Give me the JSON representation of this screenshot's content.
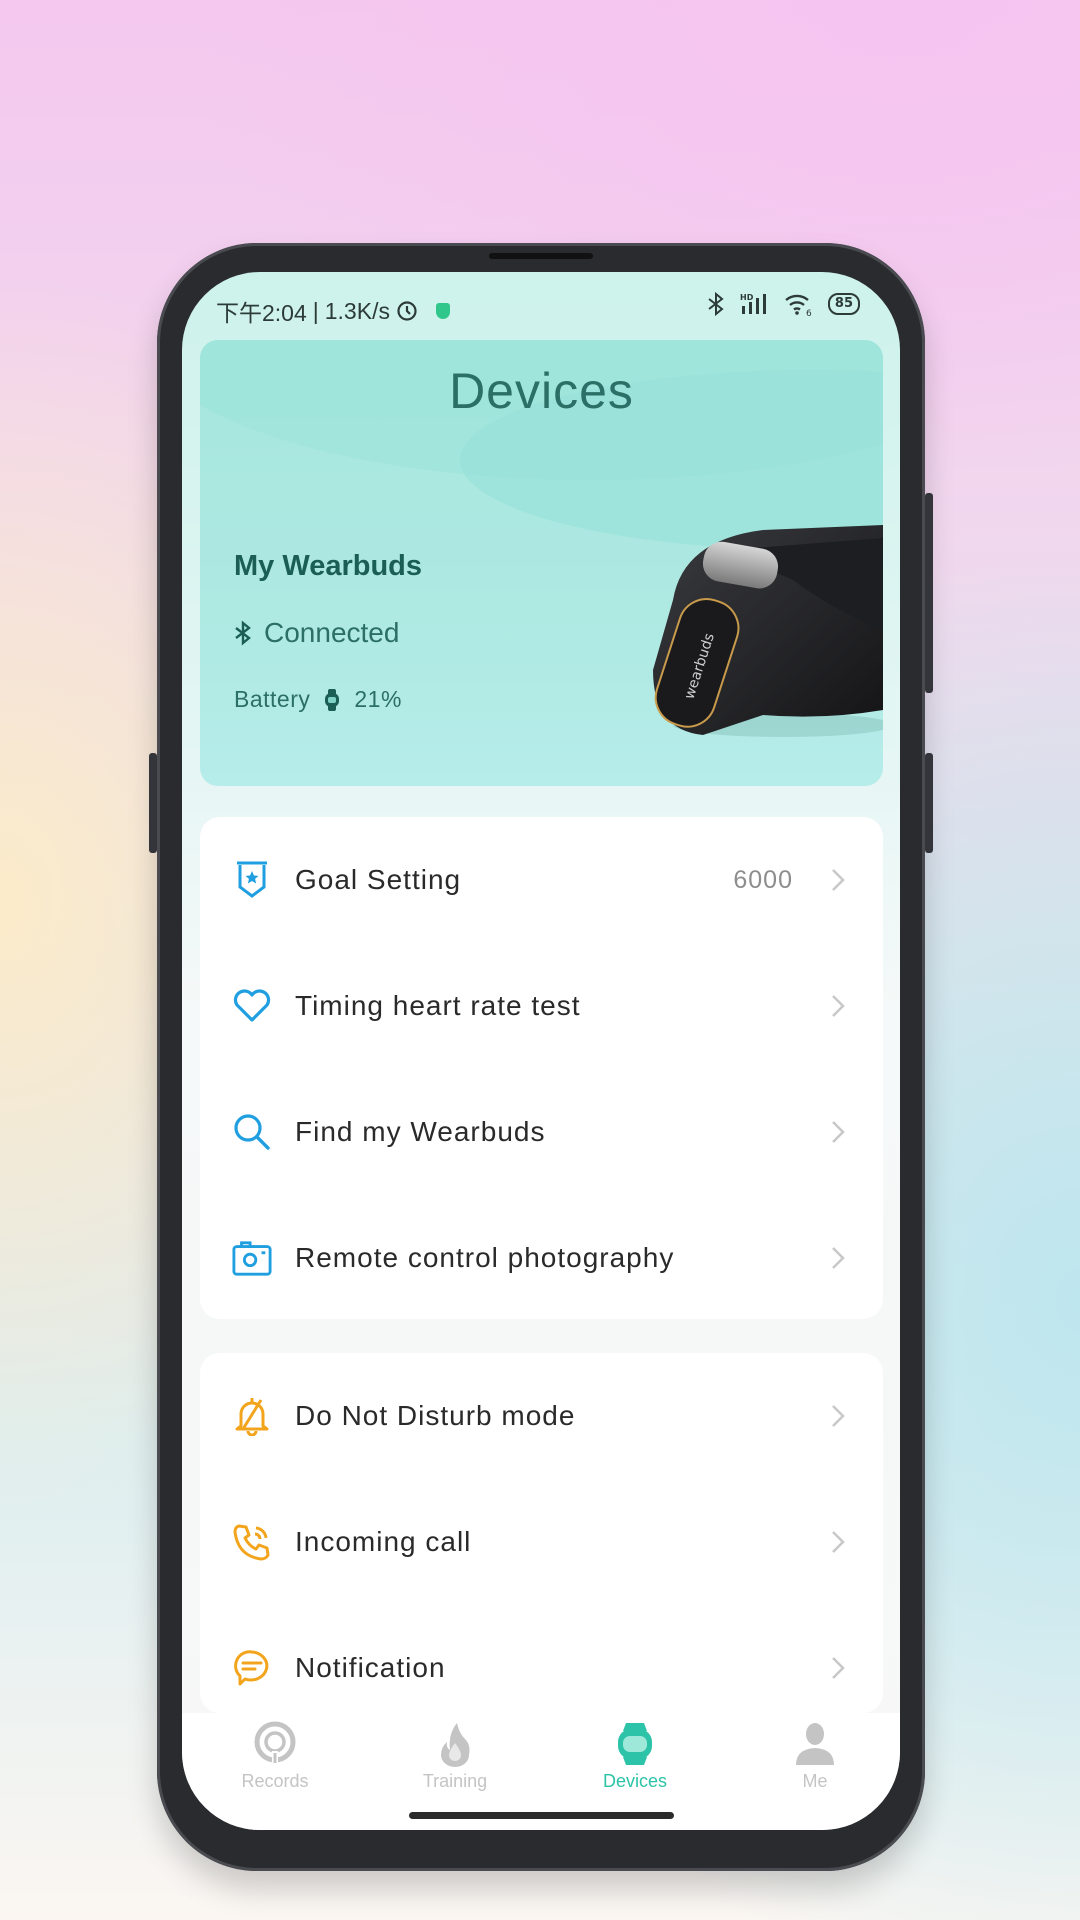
{
  "status_bar": {
    "time": "下午2:04",
    "separator": "|",
    "net_speed": "1.3K/s",
    "battery_level": "85",
    "icons": [
      "alarm-icon",
      "shield-icon",
      "bluetooth-icon",
      "hd-signal-icon",
      "wifi-icon",
      "battery-icon"
    ]
  },
  "header": {
    "title": "Devices",
    "device_name": "My Wearbuds",
    "connection_status": "Connected",
    "battery_label": "Battery",
    "battery_value": "21%",
    "image_label": "wearbuds"
  },
  "menu_group_1": [
    {
      "label": "Goal Setting",
      "value": "6000",
      "icon": "goal-badge-icon"
    },
    {
      "label": "Timing heart rate test",
      "value": "",
      "icon": "heart-icon"
    },
    {
      "label": "Find my Wearbuds",
      "value": "",
      "icon": "search-icon"
    },
    {
      "label": "Remote control photography",
      "value": "",
      "icon": "camera-icon"
    }
  ],
  "menu_group_2": [
    {
      "label": "Do Not Disturb mode",
      "value": "",
      "icon": "bell-off-icon"
    },
    {
      "label": "Incoming call",
      "value": "",
      "icon": "phone-ringing-icon"
    },
    {
      "label": "Notification",
      "value": "",
      "icon": "chat-bubble-icon"
    }
  ],
  "tabs": [
    {
      "label": "Records",
      "active": false
    },
    {
      "label": "Training",
      "active": false
    },
    {
      "label": "Devices",
      "active": true
    },
    {
      "label": "Me",
      "active": false
    }
  ],
  "colors": {
    "accent": "#2cc3a8",
    "icon_blue": "#1f9fe0",
    "icon_orange": "#f2a51c",
    "header_bg": "#aee9e2",
    "header_text": "#2b6f66",
    "inactive_tab": "#c4c4c4"
  }
}
